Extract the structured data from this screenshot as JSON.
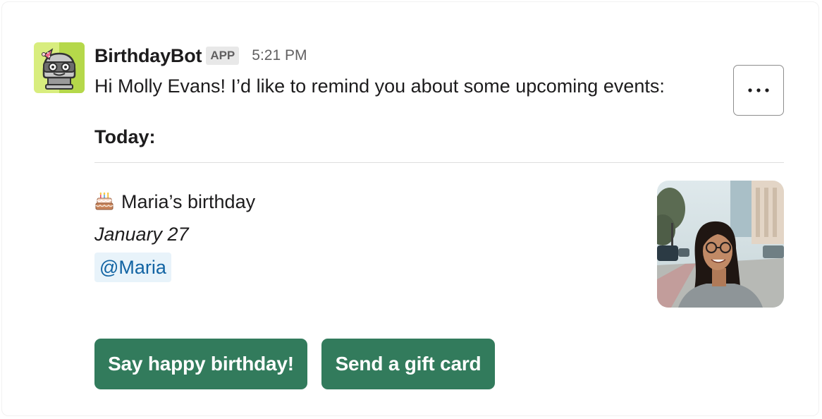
{
  "message": {
    "bot_name": "BirthdayBot",
    "badge": "APP",
    "timestamp": "5:21 PM",
    "text": "Hi Molly Evans! I’d like to remind you about some upcoming events:",
    "more_icon": "ellipsis-icon"
  },
  "section": {
    "title": "Today:"
  },
  "event": {
    "icon": "birthday-cake-icon",
    "name": "Maria’s birthday",
    "date": "January 27",
    "mention": "@Maria",
    "photo": "profile-photo-maria"
  },
  "actions": {
    "birthday_label": "Say happy birthday!",
    "gift_label": "Send a gift card"
  },
  "colors": {
    "button_bg": "#327b5c",
    "mention_bg": "#e8f3fa",
    "mention_text": "#1264a3",
    "avatar_bg": "#c4e05a"
  }
}
